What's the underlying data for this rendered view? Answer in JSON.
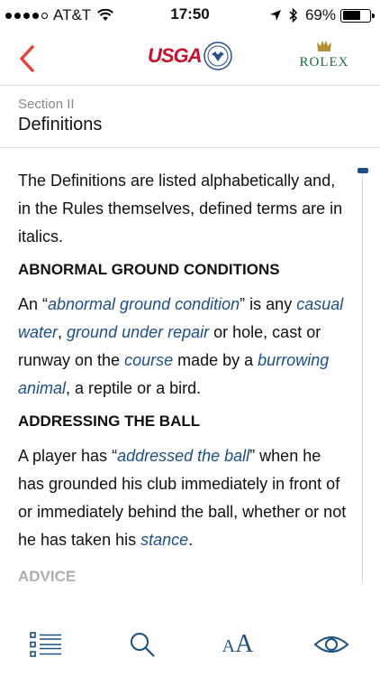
{
  "status": {
    "carrier": "AT&T",
    "time": "17:50",
    "battery": "69%",
    "battery_level": 0.69
  },
  "header": {
    "usga_logo": "USGA",
    "rolex_logo": "ROLEX"
  },
  "section": {
    "label": "Section II",
    "title": "Definitions"
  },
  "content": {
    "intro": "The Definitions are listed alphabetically and, in the Rules themselves, defined terms are in italics.",
    "abnormal": {
      "heading": "ABNORMAL GROUND CONDITIONS",
      "t1": "An “",
      "d1": "abnormal ground condition",
      "t2": "” is any ",
      "d2": "casual water",
      "t3": ", ",
      "d3": "ground under repair",
      "t4": " or hole, cast or runway on the ",
      "d4": "course",
      "t5": " made by a ",
      "d5": "burrowing animal",
      "t6": ", a reptile or a bird."
    },
    "addressing": {
      "heading": "ADDRESSING THE BALL",
      "t1": "A player has “",
      "d1": "addressed the ball",
      "t2": "” when he has grounded his club immediately in front of or immediately behind the ball, whether or not he has taken his ",
      "d2": "stance",
      "t3": "."
    },
    "advice_heading": "ADVICE"
  },
  "colors": {
    "accent": "#1b4f86",
    "back": "#e0453a",
    "usga_red": "#c8102e",
    "rolex_green": "#1f6b3a"
  },
  "toolbar": {
    "icons": [
      "list-icon",
      "search-icon",
      "text-size-icon",
      "eye-icon"
    ],
    "text_size_small": "A",
    "text_size_large": "A"
  }
}
